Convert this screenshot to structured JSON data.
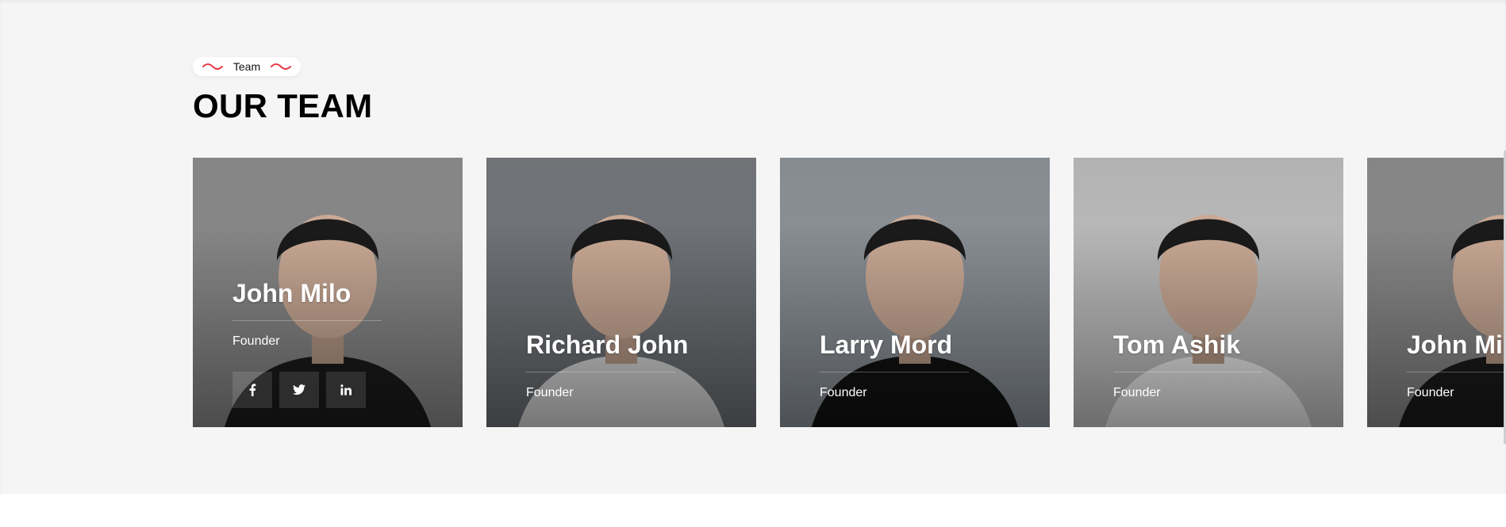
{
  "section": {
    "badge_label": "Team",
    "title": "OUR TEAM"
  },
  "team": {
    "members": [
      {
        "name": "John Milo",
        "role": "Founder",
        "tone": "#8a8a8a",
        "shirt": "#1b1b1b"
      },
      {
        "name": "Richard John",
        "role": "Founder",
        "tone": "#6d7176",
        "shirt": "#d8d8d8"
      },
      {
        "name": "Larry Mord",
        "role": "Founder",
        "tone": "#8c939a",
        "shirt": "#121212"
      },
      {
        "name": "Tom Ashik",
        "role": "Founder",
        "tone": "#c6c6c6",
        "shirt": "#eeeeee"
      },
      {
        "name": "John Milo",
        "role": "Founder",
        "tone": "#8a8a8a",
        "shirt": "#1b1b1b"
      }
    ],
    "social_icons": [
      "facebook-icon",
      "twitter-icon",
      "linkedin-icon"
    ]
  },
  "colors": {
    "accent": "#e63946",
    "section_bg": "#f5f5f5",
    "page_bg": "#ffffff"
  }
}
